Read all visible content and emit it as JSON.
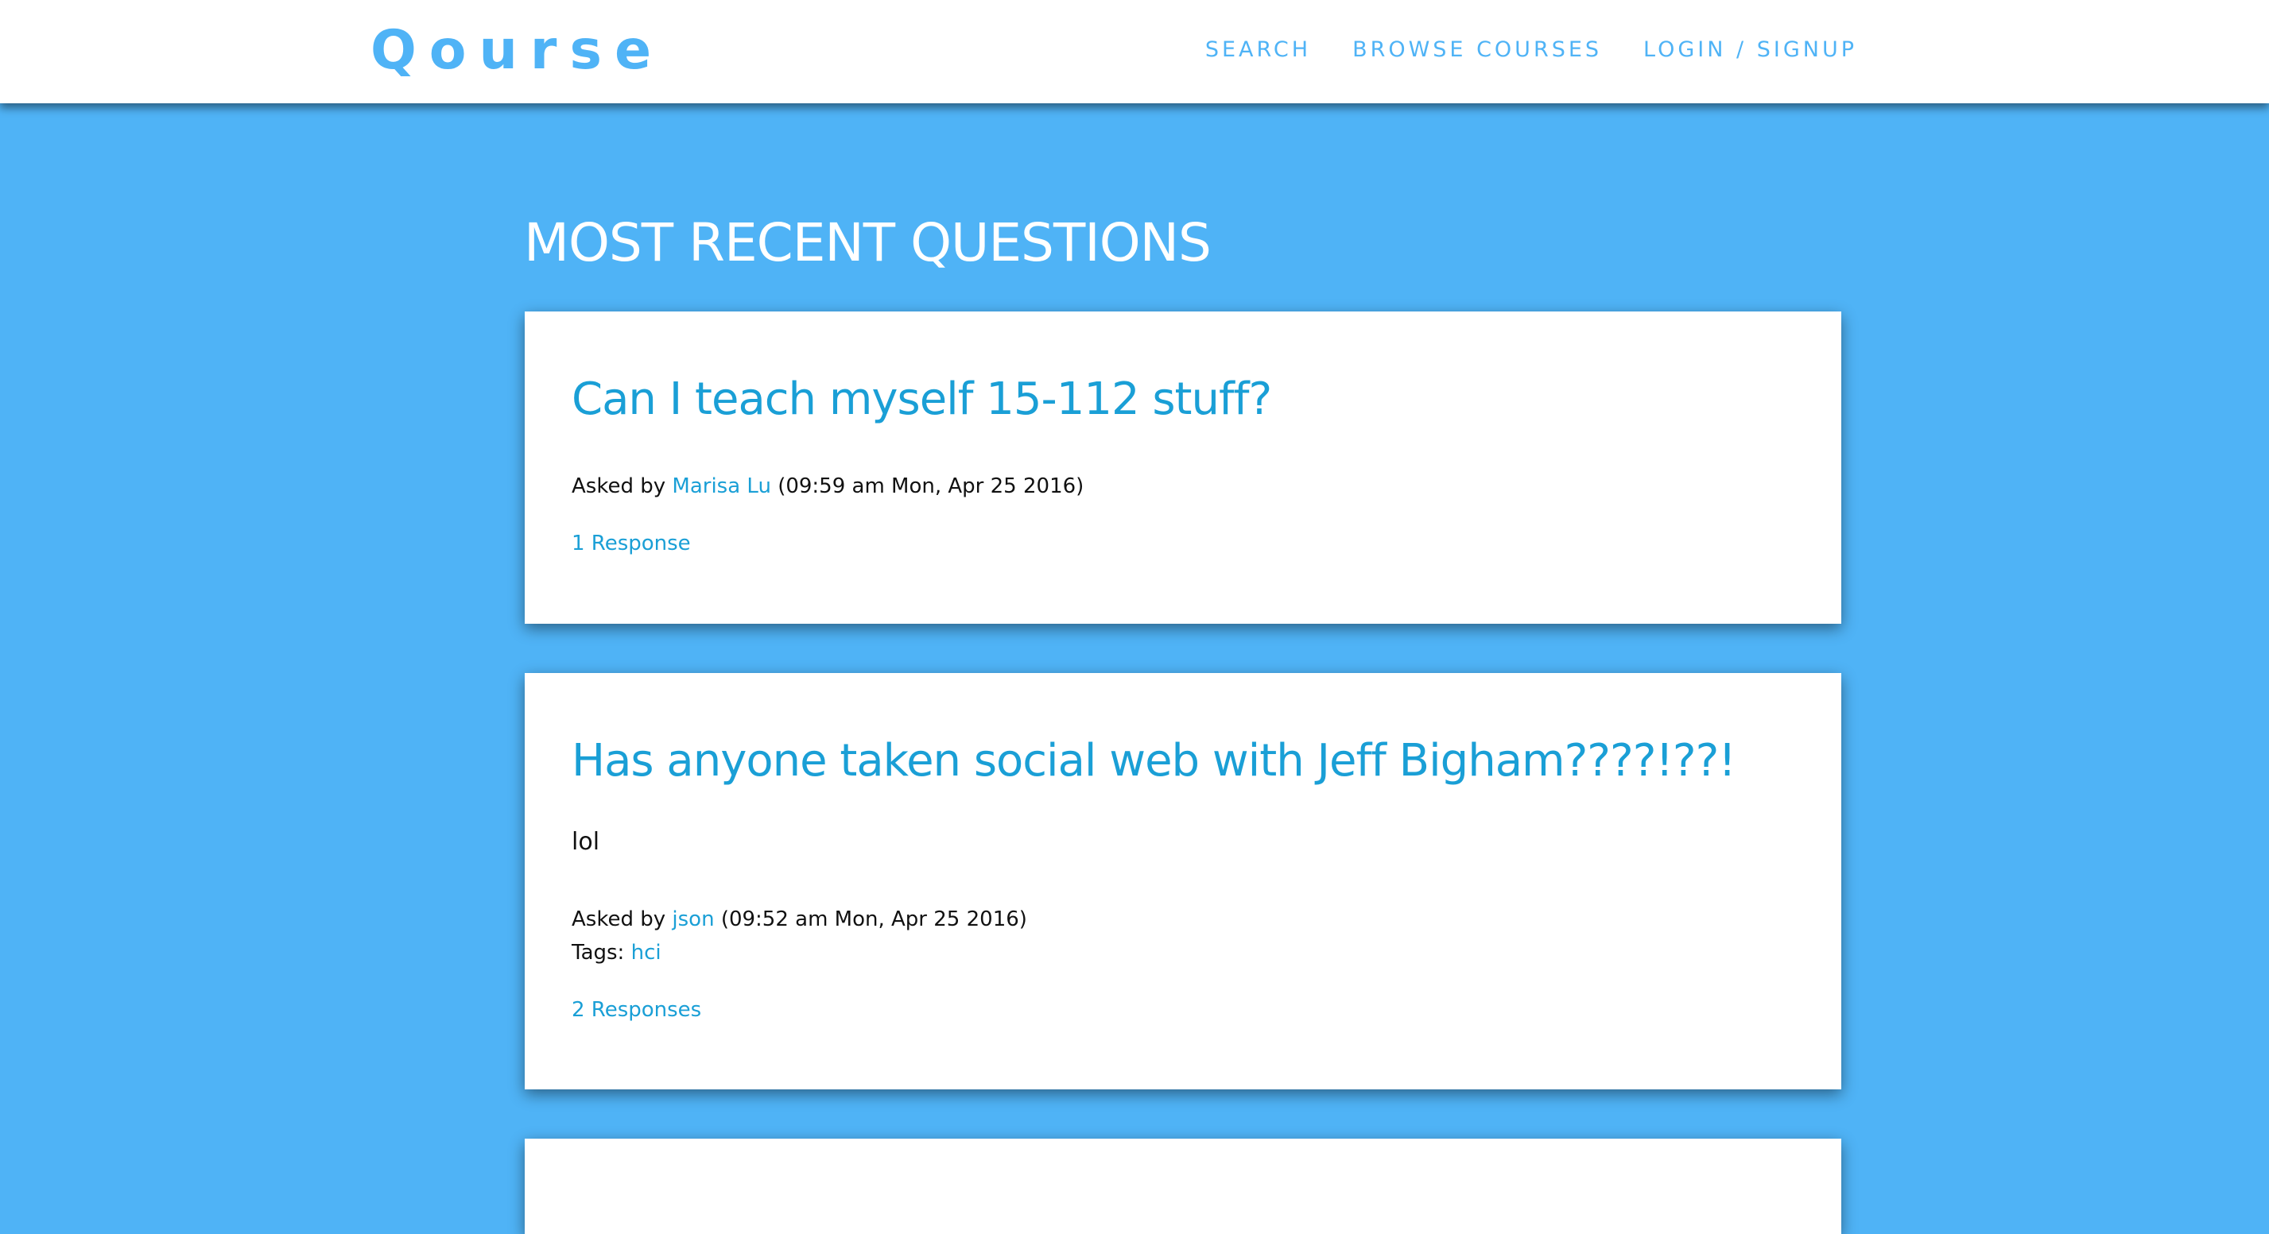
{
  "brand": {
    "logo_text": "Qourse",
    "accent_color": "#4fb3f6",
    "link_color": "#1a9fd6"
  },
  "nav": {
    "search": "SEARCH",
    "browse_courses": "BROWSE COURSES",
    "login_signup": "LOGIN / SIGNUP"
  },
  "main": {
    "title": "MOST RECENT QUESTIONS",
    "questions": [
      {
        "title": "Can I teach myself 15-112 stuff?",
        "body": "",
        "asked_by_label": "Asked by",
        "author": "Marisa Lu",
        "timestamp": "(09:59 am Mon, Apr 25 2016)",
        "responses": "1 Response"
      },
      {
        "title": "Has anyone taken social web with Jeff Bigham????!??!",
        "body": "lol",
        "asked_by_label": "Asked by",
        "author": "json",
        "timestamp": "(09:52 am Mon, Apr 25 2016)",
        "tags_label": "Tags:",
        "tag": "hci",
        "responses": "2 Responses"
      }
    ]
  }
}
